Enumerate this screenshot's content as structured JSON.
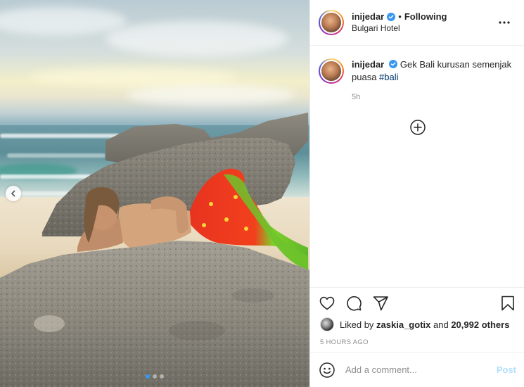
{
  "post": {
    "username": "inijedar",
    "following_label": "Following",
    "separator": "•",
    "location": "Bulgari Hotel"
  },
  "caption": {
    "username": "inijedar",
    "text": "Gek Bali kurusan semenjak puasa ",
    "hashtag": "#bali",
    "time": "5h"
  },
  "likes": {
    "prefix": "Liked by ",
    "user": "zaskia_gotix",
    "middle": " and ",
    "others": "20,992 others"
  },
  "timestamp": "5 HOURS AGO",
  "comment": {
    "placeholder": "Add a comment...",
    "post_label": "Post"
  },
  "carousel": {
    "slide_count": 3,
    "active_index": 0
  },
  "colors": {
    "verified": "#3897f0",
    "link": "#00376b",
    "post_disabled": "#b2dffc"
  },
  "icons": [
    "verified-icon",
    "more-options-icon",
    "load-more-icon",
    "heart-icon",
    "comment-icon",
    "share-icon",
    "bookmark-icon",
    "emoji-icon",
    "chevron-left-icon"
  ]
}
